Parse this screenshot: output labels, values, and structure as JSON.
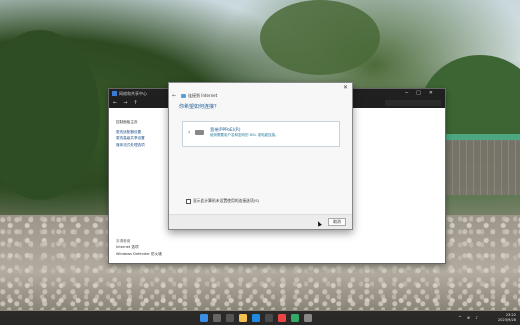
{
  "control_panel": {
    "title": "网络和共享中心",
    "sidebar_links": [
      "控制面板主页",
      "更改适配器设置",
      "更改高级共享设置",
      "媒体流式处理选项"
    ],
    "see_also_header": "另请参阅",
    "see_also_links": [
      "Internet 选项",
      "Windows Defender 防火墙"
    ]
  },
  "dialog": {
    "title": "连接到 Internet",
    "heading": "你希望如何连接？",
    "option_title": "宽带(PPPoE)(R)",
    "option_desc": "使用需要用户名和密码的 DSL 或电缆连接。",
    "checkbox_label": "显示此计算机未设置使用的连接选项(S)",
    "cancel_label": "取消"
  },
  "taskbar": {
    "time": "23:22",
    "date": "2023/9/28"
  },
  "colors": {
    "link": "#1e4f8a",
    "heading": "#1a5a96",
    "taskbar": "#1e1e1e"
  }
}
